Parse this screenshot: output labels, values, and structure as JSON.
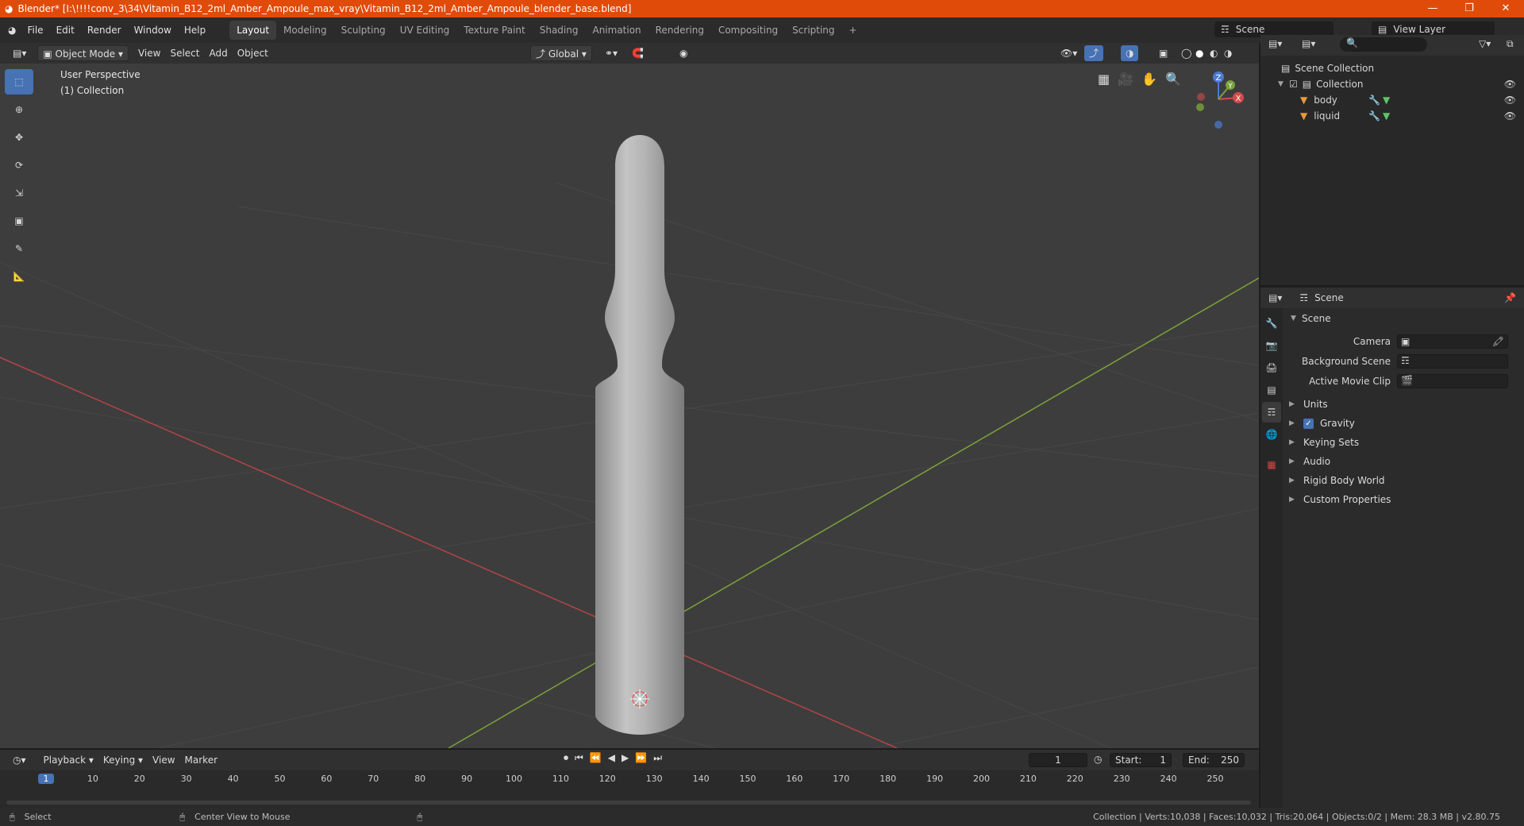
{
  "window": {
    "title": "Blender* [I:\\!!!!conv_3\\34\\Vitamin_B12_2ml_Amber_Ampoule_max_vray\\Vitamin_B12_2ml_Amber_Ampoule_blender_base.blend]",
    "min": "—",
    "restore": "❐",
    "close": "✕"
  },
  "menubar": {
    "items": [
      "File",
      "Edit",
      "Render",
      "Window",
      "Help"
    ],
    "workspaces": [
      "Layout",
      "Modeling",
      "Sculpting",
      "UV Editing",
      "Texture Paint",
      "Shading",
      "Animation",
      "Rendering",
      "Compositing",
      "Scripting"
    ],
    "active_workspace": "Layout",
    "add_tab": "+",
    "scene_label": "Scene",
    "view_layer_label": "View Layer"
  },
  "viewport_header": {
    "mode": "Object Mode",
    "menus": [
      "View",
      "Select",
      "Add",
      "Object"
    ],
    "orientation": "Global"
  },
  "viewport": {
    "perspective": "User Perspective",
    "collection": "(1) Collection",
    "gizmo": {
      "z": "Z",
      "y": "Y",
      "x": "X"
    },
    "colors": {
      "x_axis": "#c04a4a",
      "y_axis": "#7ca23a",
      "grid": "#474747",
      "bg": "#3d3d3d"
    }
  },
  "outliner": {
    "root": "Scene Collection",
    "collection": "Collection",
    "objects": [
      "body",
      "liquid"
    ]
  },
  "properties": {
    "header": "Scene",
    "panel": "Scene",
    "fields": [
      {
        "label": "Camera"
      },
      {
        "label": "Background Scene"
      },
      {
        "label": "Active Movie Clip"
      }
    ],
    "sections": [
      "Units",
      "Gravity",
      "Keying Sets",
      "Audio",
      "Rigid Body World",
      "Custom Properties"
    ],
    "gravity_checked": true
  },
  "timeline": {
    "menus": [
      "Playback",
      "Keying",
      "View",
      "Marker"
    ],
    "current_frame": "1",
    "start_label": "Start:",
    "start": "1",
    "end_label": "End:",
    "end": "250",
    "ticks": [
      "1",
      "10",
      "20",
      "30",
      "40",
      "50",
      "60",
      "70",
      "80",
      "90",
      "100",
      "110",
      "120",
      "130",
      "140",
      "150",
      "160",
      "170",
      "180",
      "190",
      "200",
      "210",
      "220",
      "230",
      "240",
      "250"
    ]
  },
  "statusbar": {
    "select": "Select",
    "center": "Center View to Mouse",
    "stats": "Collection | Verts:10,038 | Faces:10,032 | Tris:20,064 | Objects:0/2 | Mem: 28.3 MB | v2.80.75"
  }
}
